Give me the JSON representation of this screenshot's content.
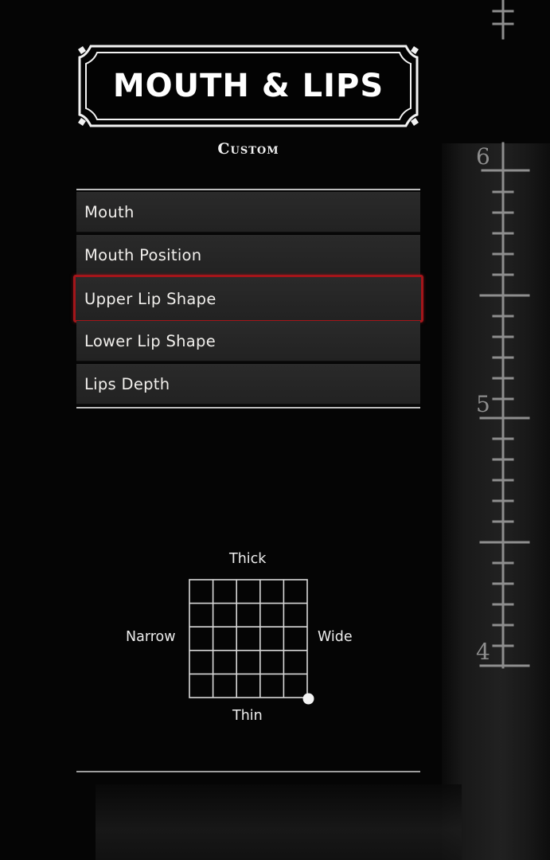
{
  "header": {
    "title": "MOUTH & LIPS",
    "subtitle": "Custom"
  },
  "menu": {
    "items": [
      {
        "label": "Mouth",
        "selected": false
      },
      {
        "label": "Mouth Position",
        "selected": false
      },
      {
        "label": "Upper Lip Shape",
        "selected": true
      },
      {
        "label": "Lower Lip Shape",
        "selected": false
      },
      {
        "label": "Lips Depth",
        "selected": false
      }
    ]
  },
  "shape_grid": {
    "top_label": "Thick",
    "bottom_label": "Thin",
    "left_label": "Narrow",
    "right_label": "Wide",
    "cursor": {
      "horizontal": 1.0,
      "vertical": 0.0
    }
  },
  "ruler": {
    "labels": [
      "6",
      "5",
      "4"
    ]
  },
  "colors": {
    "selection": "#a4151a",
    "text": "#f1efec",
    "background": "#050505"
  }
}
